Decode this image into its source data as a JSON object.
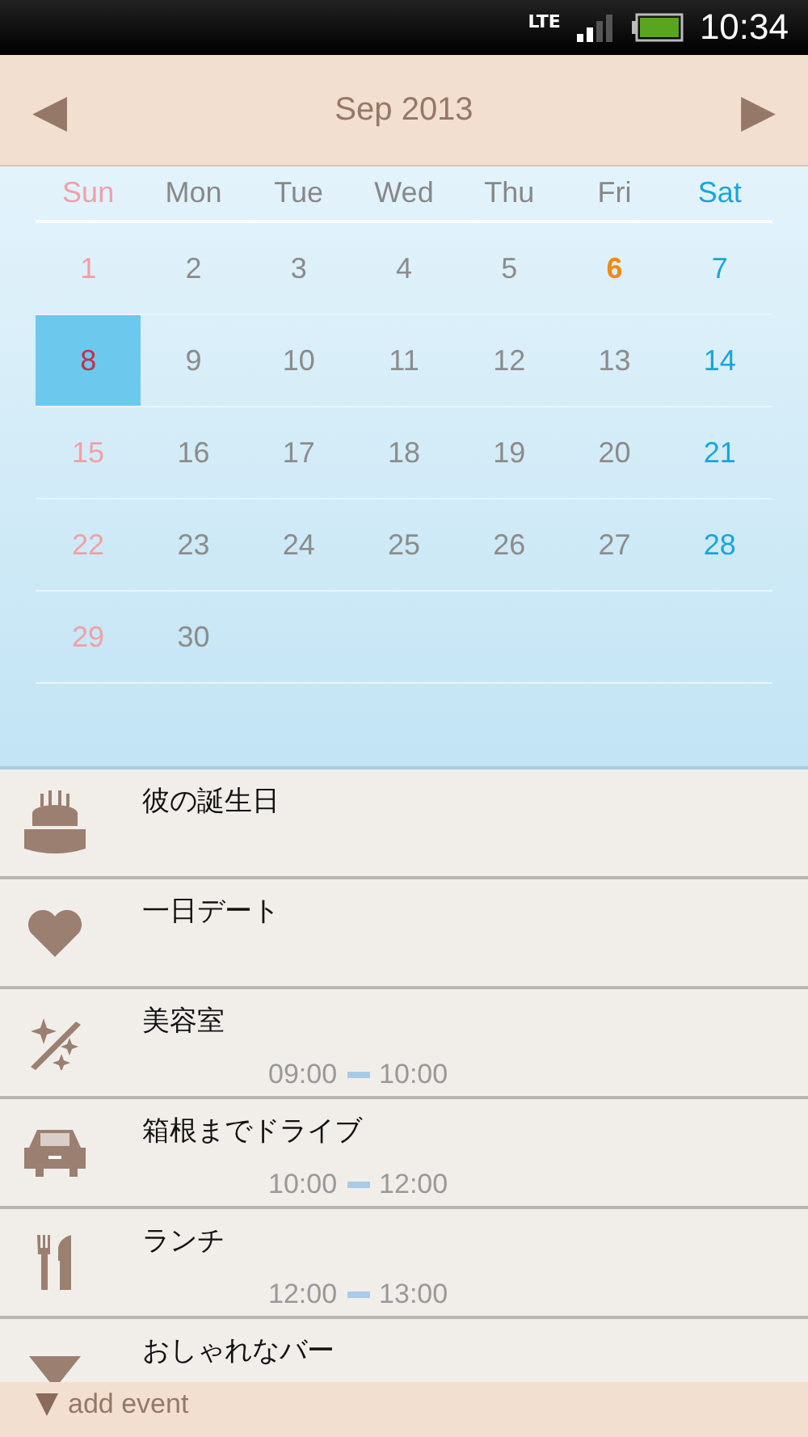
{
  "status_bar": {
    "network": "LTE",
    "time": "10:34"
  },
  "header": {
    "prev": "◀",
    "title": "Sep 2013",
    "next": "▶"
  },
  "calendar": {
    "weekdays": [
      "Sun",
      "Mon",
      "Tue",
      "Wed",
      "Thu",
      "Fri",
      "Sat"
    ],
    "weeks": [
      [
        {
          "day": "1",
          "selected": false,
          "today": false
        },
        {
          "day": "2",
          "selected": false,
          "today": false
        },
        {
          "day": "3",
          "selected": false,
          "today": false
        },
        {
          "day": "4",
          "selected": false,
          "today": false
        },
        {
          "day": "5",
          "selected": false,
          "today": false
        },
        {
          "day": "6",
          "selected": false,
          "today": true
        },
        {
          "day": "7",
          "selected": false,
          "today": false
        }
      ],
      [
        {
          "day": "8",
          "selected": true,
          "today": false
        },
        {
          "day": "9",
          "selected": false,
          "today": false
        },
        {
          "day": "10",
          "selected": false,
          "today": false
        },
        {
          "day": "11",
          "selected": false,
          "today": false
        },
        {
          "day": "12",
          "selected": false,
          "today": false
        },
        {
          "day": "13",
          "selected": false,
          "today": false
        },
        {
          "day": "14",
          "selected": false,
          "today": false
        }
      ],
      [
        {
          "day": "15",
          "selected": false,
          "today": false
        },
        {
          "day": "16",
          "selected": false,
          "today": false
        },
        {
          "day": "17",
          "selected": false,
          "today": false
        },
        {
          "day": "18",
          "selected": false,
          "today": false
        },
        {
          "day": "19",
          "selected": false,
          "today": false
        },
        {
          "day": "20",
          "selected": false,
          "today": false
        },
        {
          "day": "21",
          "selected": false,
          "today": false
        }
      ],
      [
        {
          "day": "22",
          "selected": false,
          "today": false
        },
        {
          "day": "23",
          "selected": false,
          "today": false
        },
        {
          "day": "24",
          "selected": false,
          "today": false
        },
        {
          "day": "25",
          "selected": false,
          "today": false
        },
        {
          "day": "26",
          "selected": false,
          "today": false
        },
        {
          "day": "27",
          "selected": false,
          "today": false
        },
        {
          "day": "28",
          "selected": false,
          "today": false
        }
      ],
      [
        {
          "day": "29",
          "selected": false,
          "today": false
        },
        {
          "day": "30",
          "selected": false,
          "today": false
        }
      ]
    ]
  },
  "events": [
    {
      "kind": "cake",
      "title": "彼の誕生日"
    },
    {
      "kind": "heart",
      "title": "一日デート"
    },
    {
      "kind": "sparkle",
      "title": "美容室",
      "start": "09:00",
      "end": "10:00"
    },
    {
      "kind": "car",
      "title": "箱根までドライブ",
      "start": "10:00",
      "end": "12:00"
    },
    {
      "kind": "cutlery",
      "title": "ランチ",
      "start": "12:00",
      "end": "13:00"
    },
    {
      "kind": "cocktail",
      "title": "おしゃれなバー"
    }
  ],
  "footer": {
    "label": "add event"
  }
}
